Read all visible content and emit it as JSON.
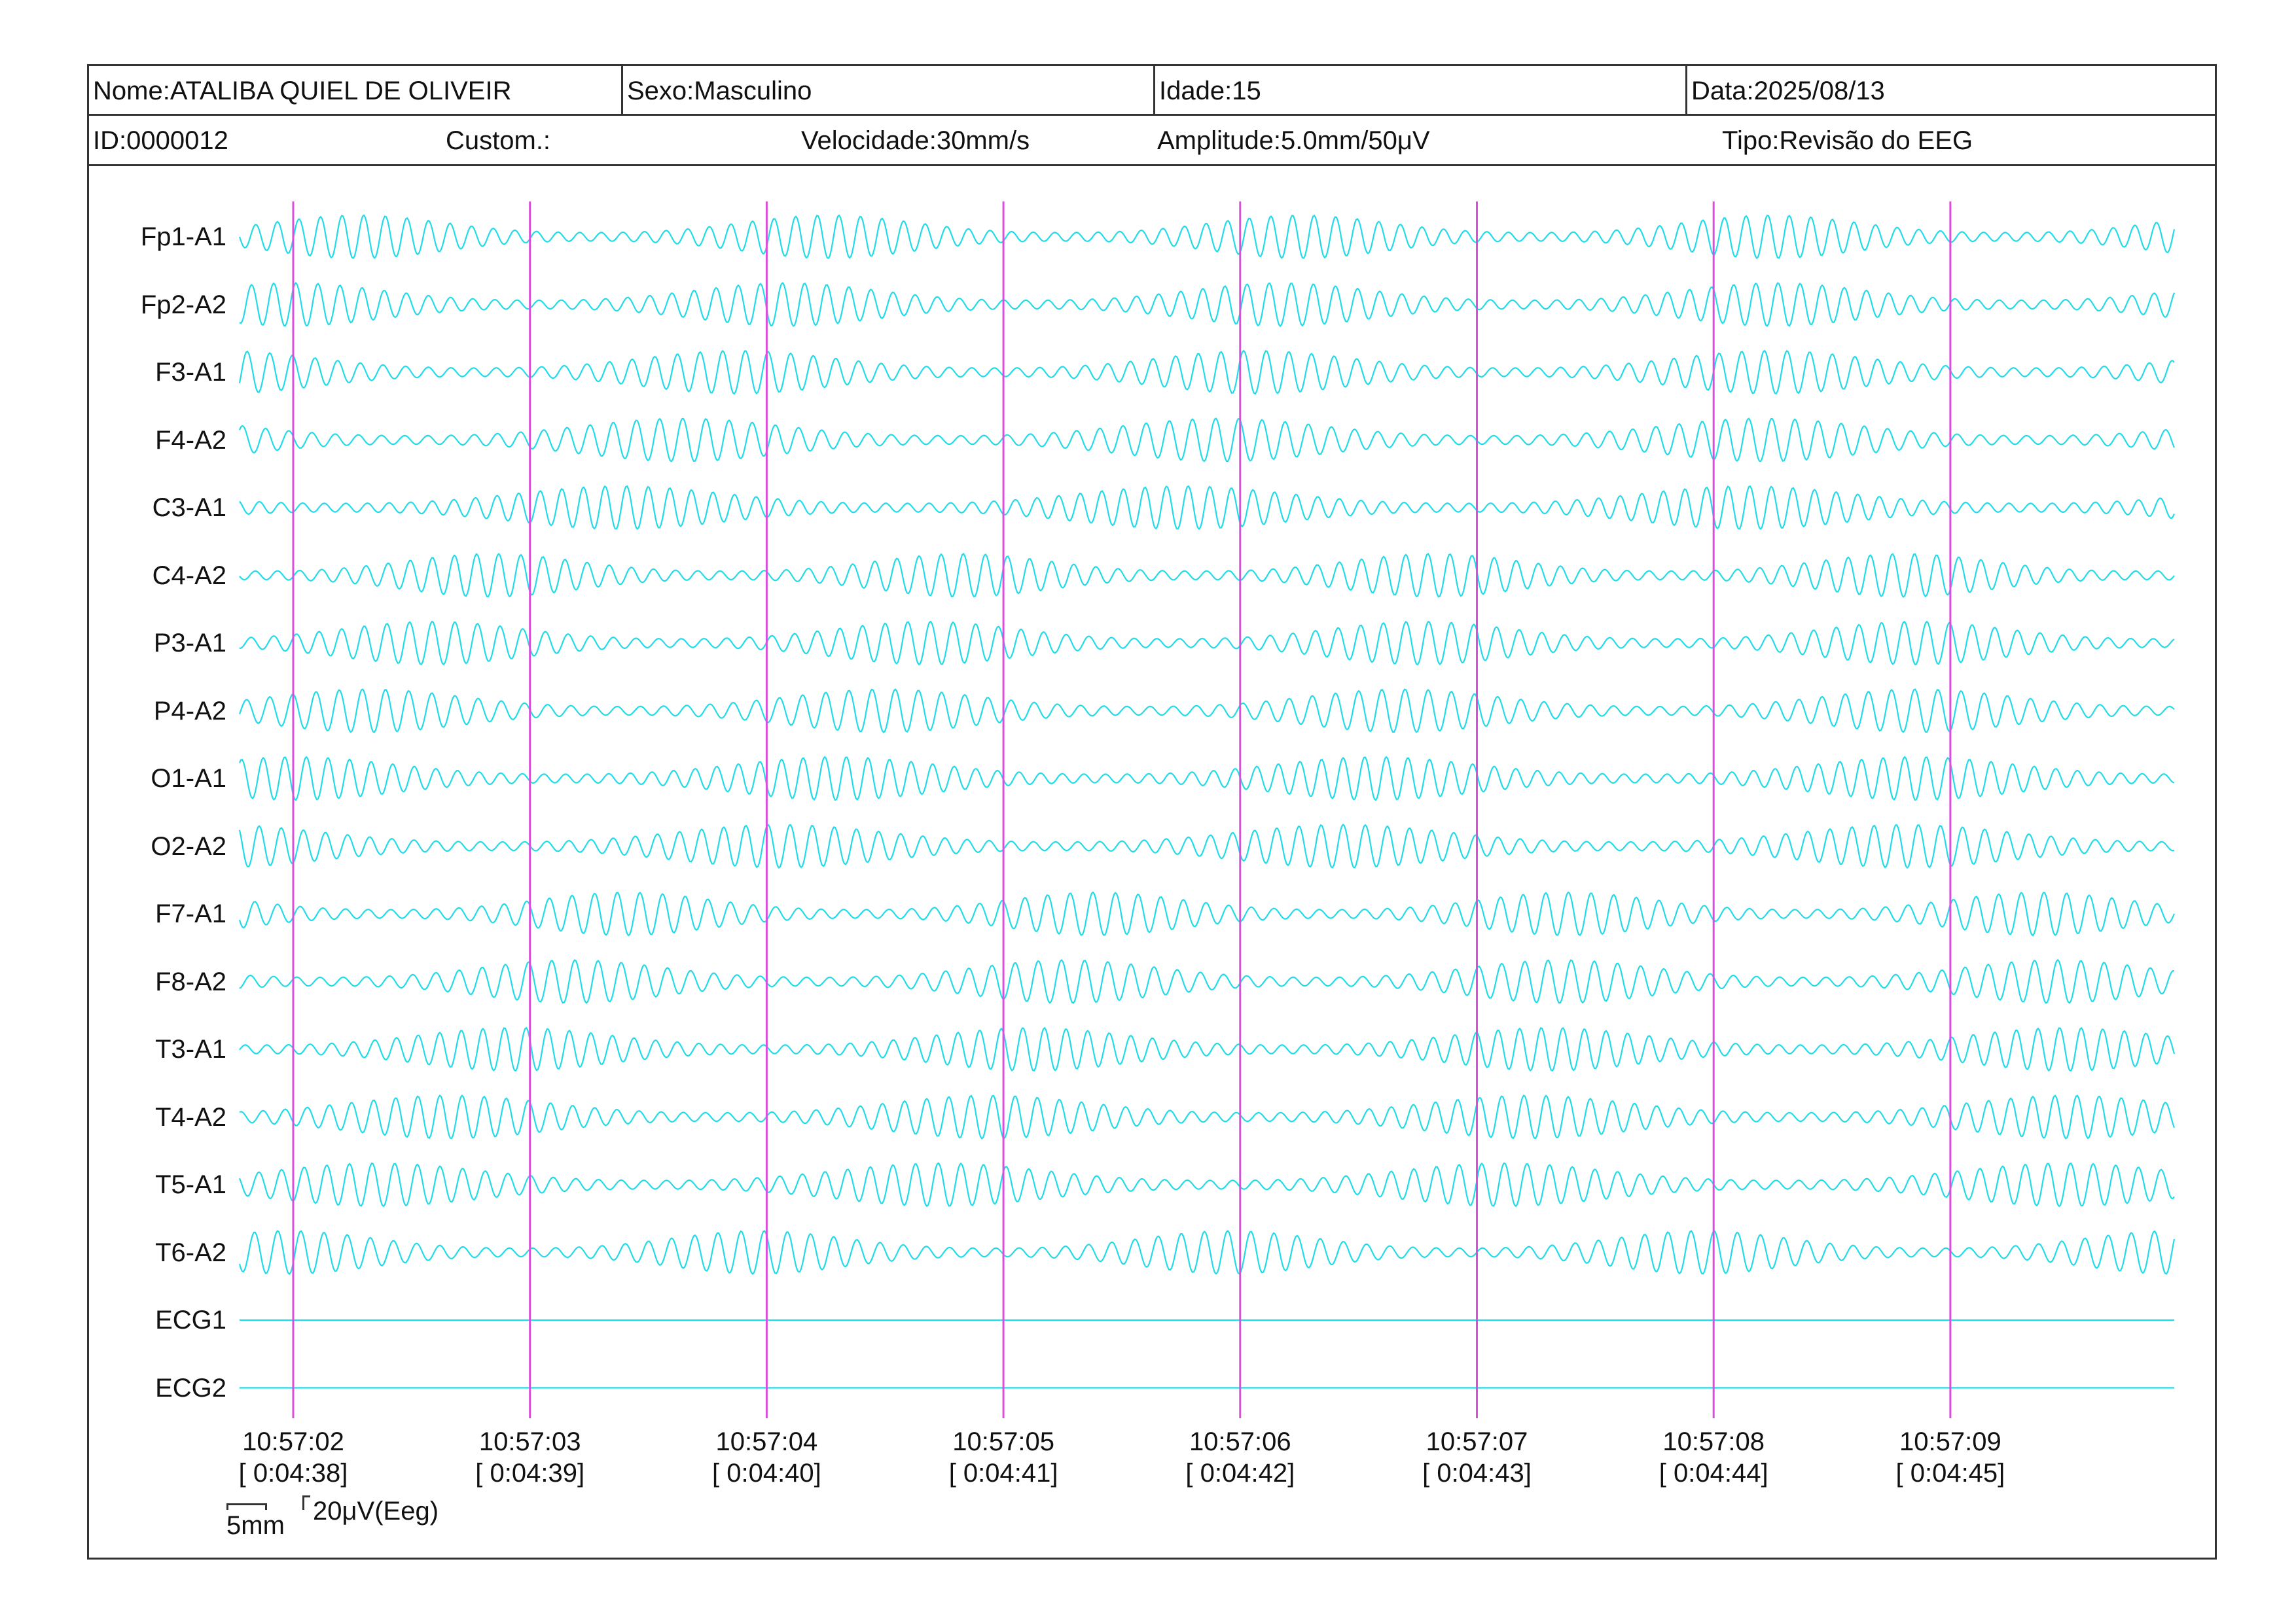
{
  "header": {
    "name": "Nome:ATALIBA QUIEL DE OLIVEIR",
    "sex": "Sexo:Masculino",
    "age": "Idade:15",
    "date": "Data:2025/08/13",
    "id": "ID:0000012",
    "custom": "Custom.:",
    "speed": "Velocidade:30mm/s",
    "amplitude": "Amplitude:5.0mm/50μV",
    "type": "Tipo:Revisão do EEG"
  },
  "channels": [
    {
      "label": "Fp1-A1",
      "kind": "eeg"
    },
    {
      "label": "Fp2-A2",
      "kind": "eeg"
    },
    {
      "label": "F3-A1",
      "kind": "eeg"
    },
    {
      "label": "F4-A2",
      "kind": "eeg"
    },
    {
      "label": "C3-A1",
      "kind": "eeg"
    },
    {
      "label": "C4-A2",
      "kind": "eeg"
    },
    {
      "label": "P3-A1",
      "kind": "eeg"
    },
    {
      "label": "P4-A2",
      "kind": "eeg"
    },
    {
      "label": "O1-A1",
      "kind": "eeg"
    },
    {
      "label": "O2-A2",
      "kind": "eeg"
    },
    {
      "label": "F7-A1",
      "kind": "eeg"
    },
    {
      "label": "F8-A2",
      "kind": "eeg"
    },
    {
      "label": "T3-A1",
      "kind": "eeg"
    },
    {
      "label": "T4-A2",
      "kind": "eeg"
    },
    {
      "label": "T5-A1",
      "kind": "eeg"
    },
    {
      "label": "T6-A2",
      "kind": "eeg"
    },
    {
      "label": "ECG1",
      "kind": "flat"
    },
    {
      "label": "ECG2",
      "kind": "flat"
    }
  ],
  "time_marks": [
    {
      "clock": "10:57:02",
      "elapsed": "[ 0:04:38]"
    },
    {
      "clock": "10:57:03",
      "elapsed": "[ 0:04:39]"
    },
    {
      "clock": "10:57:04",
      "elapsed": "[ 0:04:40]"
    },
    {
      "clock": "10:57:05",
      "elapsed": "[ 0:04:41]"
    },
    {
      "clock": "10:57:06",
      "elapsed": "[ 0:04:42]"
    },
    {
      "clock": "10:57:07",
      "elapsed": "[ 0:04:43]"
    },
    {
      "clock": "10:57:08",
      "elapsed": "[ 0:04:44]"
    },
    {
      "clock": "10:57:09",
      "elapsed": "[ 0:04:45]"
    }
  ],
  "scale": {
    "time_label": "5mm",
    "amplitude_label": "20μV(Eeg)"
  },
  "colors": {
    "trace": "#22dbe8",
    "second_marker": "#d94fd9",
    "frame": "#333333"
  }
}
